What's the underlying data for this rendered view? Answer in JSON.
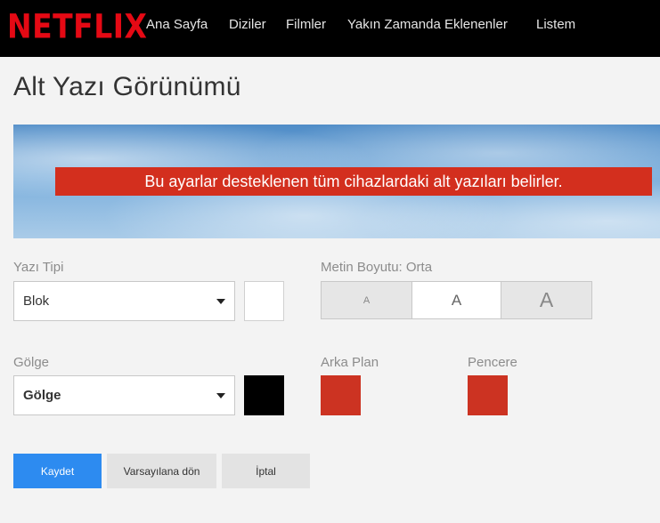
{
  "brand": {
    "logo_text": "NETFLIX",
    "color": "#e50914"
  },
  "nav": {
    "items": [
      {
        "label": "Ana Sayfa"
      },
      {
        "label": "Diziler"
      },
      {
        "label": "Filmler"
      },
      {
        "label": "Yakın Zamanda Eklenenler"
      },
      {
        "label": "Listem"
      }
    ]
  },
  "page": {
    "title": "Alt Yazı Görünümü"
  },
  "preview": {
    "banner_text": "Bu ayarlar desteklenen tüm cihazlardaki alt yazıları belirler.",
    "banner_color": "#d32f1e"
  },
  "font": {
    "label": "Yazı Tipi",
    "selected": "Blok",
    "color": "#ffffff"
  },
  "text_size": {
    "label": "Metin Boyutu: Orta",
    "options": [
      {
        "label": "A",
        "size": "small",
        "selected": false
      },
      {
        "label": "A",
        "size": "medium",
        "selected": true
      },
      {
        "label": "A",
        "size": "large",
        "selected": false
      }
    ]
  },
  "shadow": {
    "label": "Gölge",
    "selected": "Gölge",
    "color": "#000000"
  },
  "background": {
    "label": "Arka Plan",
    "color": "#cc3322"
  },
  "window": {
    "label": "Pencere",
    "color": "#cc3322"
  },
  "actions": {
    "save": "Kaydet",
    "reset": "Varsayılana dön",
    "cancel": "İptal"
  }
}
